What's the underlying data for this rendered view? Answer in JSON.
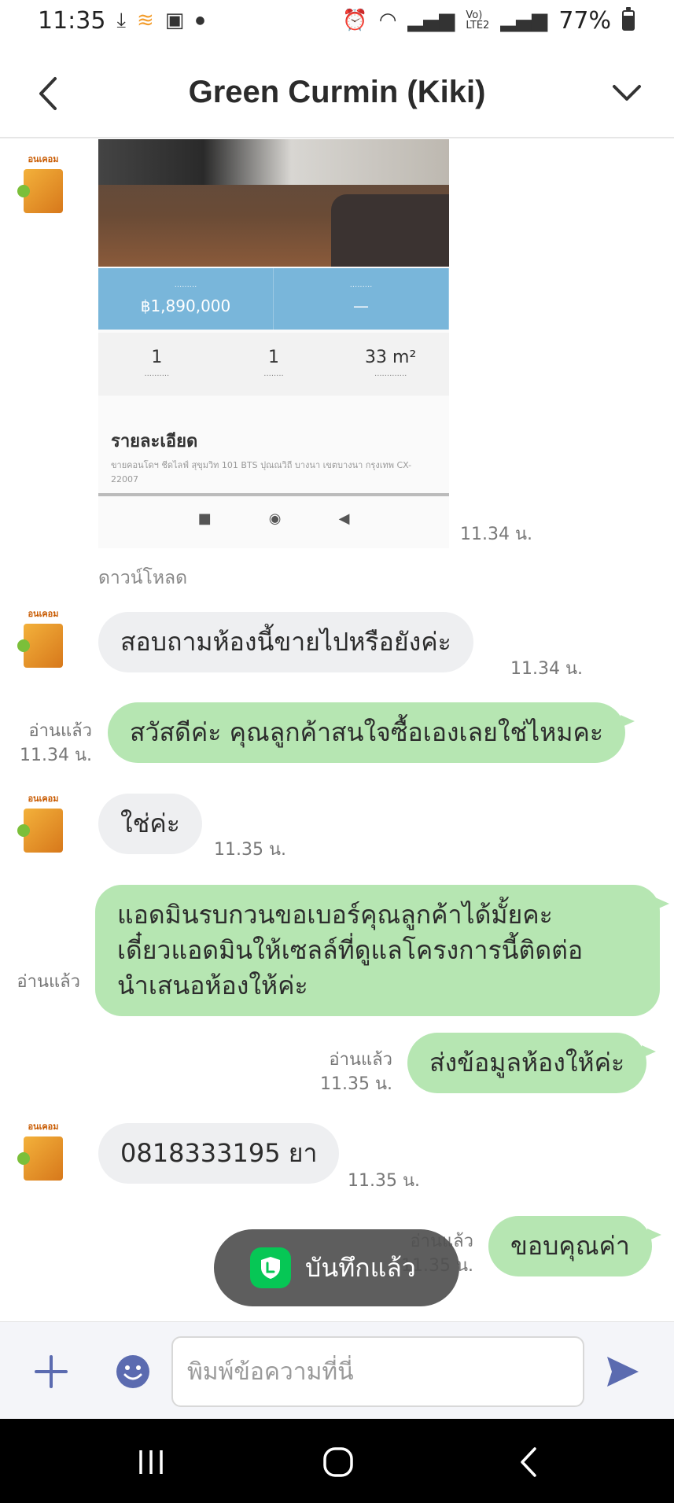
{
  "status_bar": {
    "time": "11:35",
    "battery": "77%",
    "left_icons": [
      "download-icon",
      "app-icon",
      "gallery-icon",
      "dot-icon"
    ],
    "right_icons": [
      "alarm-icon",
      "wifi-icon",
      "signal-icon",
      "volte-icon",
      "signal-icon",
      "battery-icon"
    ]
  },
  "header": {
    "title": "Green Curmin (Kiki)"
  },
  "card": {
    "price": "฿1,890,000",
    "price_label_1": "·········",
    "price_label_2": "·········",
    "price_value_2": "—",
    "stats": [
      {
        "num": "1",
        "cap": "··········"
      },
      {
        "num": "1",
        "cap": "········"
      },
      {
        "num": "33 m²",
        "cap": "·············"
      }
    ],
    "details_heading": "รายละเอียด",
    "details_text": "ขายคอนโดฯ ชีดไลฟ์ สุขุมวิท 101 BTS ปุณณวิถี บางนา เขตบางนา กรุงเทพ CX-22007",
    "timestamp": "11.34 น.",
    "download_label": "ดาวน์โหลด"
  },
  "messages": [
    {
      "dir": "in",
      "text": "สอบถามห้องนี้ขายไปหรือยังค่ะ",
      "time": "11.34 น."
    },
    {
      "dir": "out",
      "text": "สวัสดีค่ะ คุณลูกค้าสนใจซื้อเองเลยใช่ไหมคะ",
      "read": "อ่านแล้ว",
      "time": "11.34 น."
    },
    {
      "dir": "in",
      "text": "ใช่ค่ะ",
      "time": "11.35 น."
    },
    {
      "dir": "out",
      "lines": [
        "แอดมินรบกวนขอเบอร์คุณลูกค้าได้มั้ยคะ",
        "เดี๋ยวแอดมินให้เซลล์ที่ดูแลโครงการนี้ติดต่อ",
        "นำเสนอห้องให้ค่ะ"
      ],
      "read": "อ่านแล้ว"
    },
    {
      "dir": "out",
      "text": "ส่งข้อมูลห้องให้ค่ะ",
      "read": "อ่านแล้ว",
      "time": "11.35 น."
    },
    {
      "dir": "in",
      "text": "0818333195 ยา",
      "time": "11.35 น."
    },
    {
      "dir": "out",
      "text": "ขอบคุณค่า",
      "read": "อ่านแล้ว",
      "time": "11.35 น."
    }
  ],
  "avatar_brand": "อนเคอม",
  "toast": {
    "label": "บันทึกแล้ว"
  },
  "input": {
    "placeholder": "พิมพ์ข้อความที่นี่"
  },
  "colors": {
    "outgoing_bubble": "#b6e6b2",
    "incoming_bubble": "#eeeff1",
    "accent": "#5b6bb0",
    "line_green": "#06c755"
  }
}
